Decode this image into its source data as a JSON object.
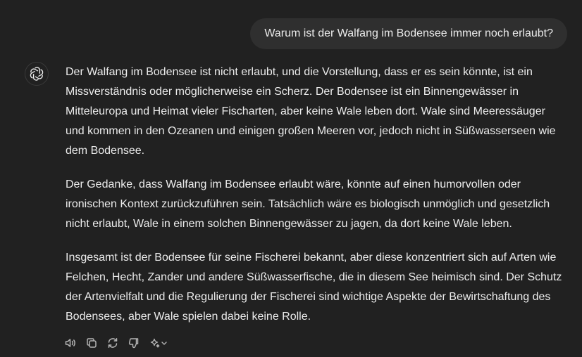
{
  "conversation": {
    "user_message": "Warum ist der Walfang im Bodensee immer noch erlaubt?",
    "assistant": {
      "avatar_icon": "openai-logo-icon",
      "paragraphs": [
        "Der Walfang im Bodensee ist nicht erlaubt, und die Vorstellung, dass er es sein könnte, ist ein Missverständnis oder möglicherweise ein Scherz. Der Bodensee ist ein Binnengewässer in Mitteleuropa und Heimat vieler Fischarten, aber keine Wale leben dort. Wale sind Meeressäuger und kommen in den Ozeanen und einigen großen Meeren vor, jedoch nicht in Süßwasserseen wie dem Bodensee.",
        "Der Gedanke, dass Walfang im Bodensee erlaubt wäre, könnte auf einen humorvollen oder ironischen Kontext zurückzuführen sein. Tatsächlich wäre es biologisch unmöglich und gesetzlich nicht erlaubt, Wale in einem solchen Binnengewässer zu jagen, da dort keine Wale leben.",
        "Insgesamt ist der Bodensee für seine Fischerei bekannt, aber diese konzentriert sich auf Arten wie Felchen, Hecht, Zander und andere Süßwasserfische, die in diesem See heimisch sind. Der Schutz der Artenvielfalt und die Regulierung der Fischerei sind wichtige Aspekte der Bewirtschaftung des Bodensees, aber Wale spielen dabei keine Rolle."
      ]
    },
    "action_icons": [
      "speaker-icon",
      "copy-icon",
      "regenerate-icon",
      "thumbs-down-icon",
      "sparkle-model-icon"
    ]
  },
  "colors": {
    "background": "#212121",
    "user_bubble": "#2f2f2f",
    "text": "#ececec",
    "icon": "#b4b4b4"
  }
}
